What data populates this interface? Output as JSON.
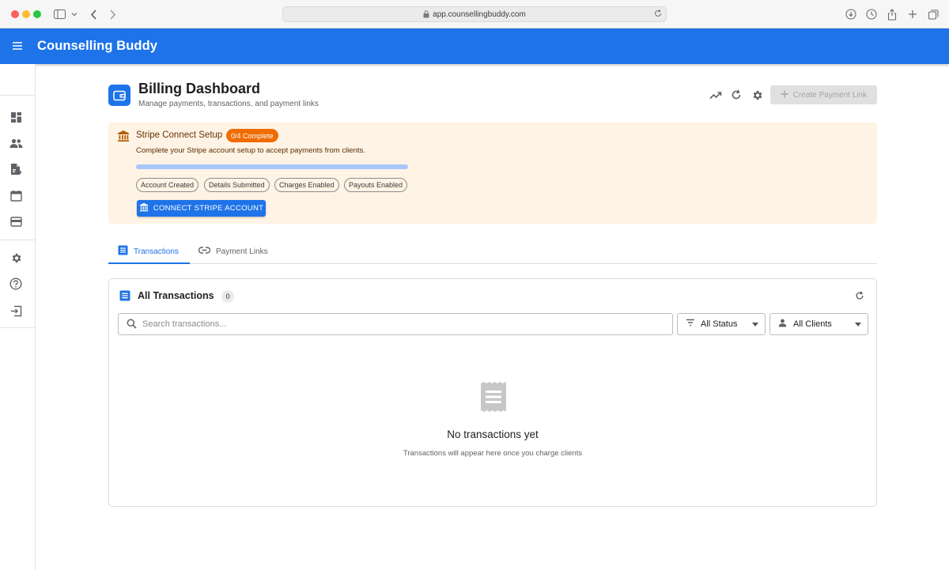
{
  "browser": {
    "url": "app.counsellingbuddy.com"
  },
  "app": {
    "title": "Counselling Buddy",
    "brand_color": "#1e73e8"
  },
  "sidebar": {
    "items": [
      {
        "icon": "dashboard-icon"
      },
      {
        "icon": "people-icon"
      },
      {
        "icon": "document-icon"
      },
      {
        "icon": "calendar-icon"
      },
      {
        "icon": "wallet-icon"
      },
      {
        "icon": "gear-icon"
      },
      {
        "icon": "help-icon"
      },
      {
        "icon": "logout-icon"
      }
    ]
  },
  "header": {
    "title": "Billing Dashboard",
    "subtitle": "Manage payments, transactions, and payment links",
    "create_button": "Create Payment Link"
  },
  "stripe": {
    "title": "Stripe Connect Setup",
    "badge": "0/4 Complete",
    "description": "Complete your Stripe account setup to accept payments from clients.",
    "progress": 0,
    "steps": [
      "Account Created",
      "Details Submitted",
      "Charges Enabled",
      "Payouts Enabled"
    ],
    "connect_button": "CONNECT STRIPE ACCOUNT"
  },
  "tabs": [
    {
      "label": "Transactions",
      "active": true
    },
    {
      "label": "Payment Links",
      "active": false
    }
  ],
  "transactions": {
    "title": "All Transactions",
    "count": "0",
    "search_placeholder": "Search transactions...",
    "status_filter": "All Status",
    "client_filter": "All Clients",
    "empty_title": "No transactions yet",
    "empty_subtitle": "Transactions will appear here once you charge clients"
  }
}
